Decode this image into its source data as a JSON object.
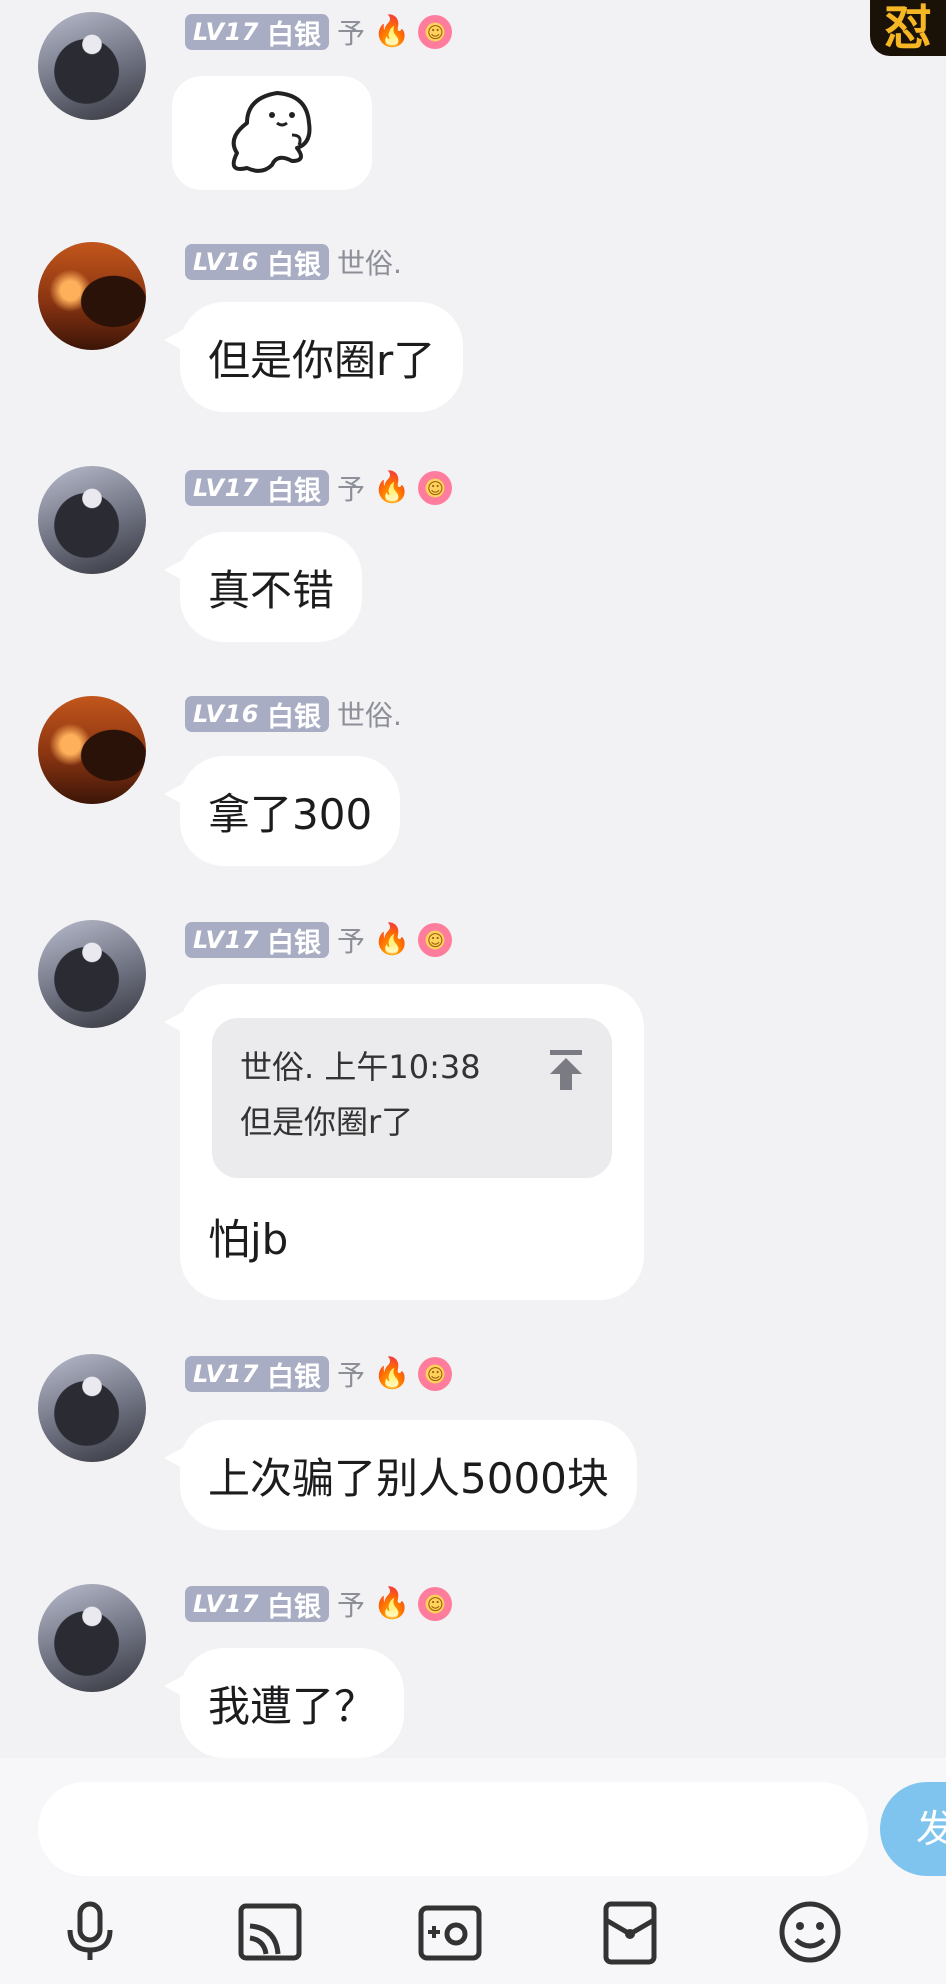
{
  "corner_sticker": "怼",
  "messages": [
    {
      "level": "LV17",
      "rank": "白银",
      "nick": "予",
      "type": "sticker"
    },
    {
      "level": "LV16",
      "rank": "白银",
      "nick": "世俗.",
      "text": "但是你圈r了"
    },
    {
      "level": "LV17",
      "rank": "白银",
      "nick": "予",
      "text": "真不错"
    },
    {
      "level": "LV16",
      "rank": "白银",
      "nick": "世俗.",
      "text": "拿了300"
    },
    {
      "level": "LV17",
      "rank": "白银",
      "nick": "予",
      "quote": {
        "header": "世俗. 上午10:38",
        "text": "但是你圈r了"
      },
      "text": "怕jb"
    },
    {
      "level": "LV17",
      "rank": "白银",
      "nick": "予",
      "text": "上次骗了别人5000块"
    },
    {
      "level": "LV17",
      "rank": "白银",
      "nick": "予",
      "text": "我遭了？"
    }
  ],
  "composer": {
    "placeholder": "",
    "send_label": "发",
    "tools": [
      "microphone-icon",
      "cast-screen-icon",
      "camera-icon",
      "red-packet-icon",
      "emoji-icon"
    ]
  },
  "colors": {
    "background": "#f2f2f4",
    "badge": "#a9adc4",
    "send": "#7ec4ee"
  }
}
